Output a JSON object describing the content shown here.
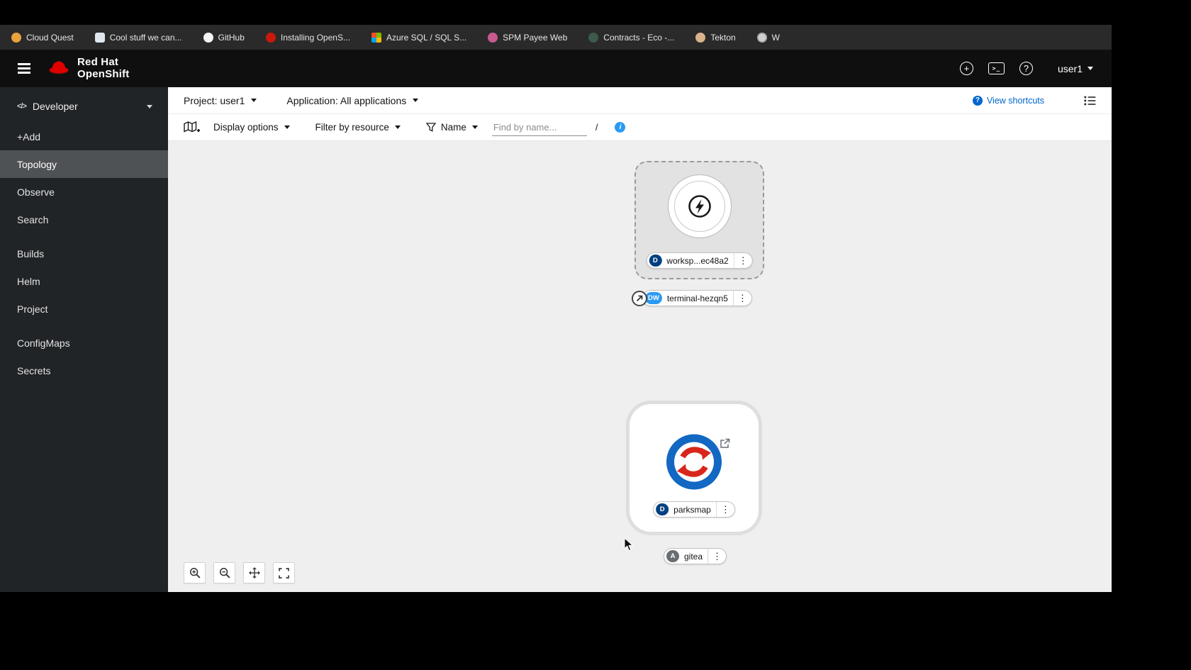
{
  "bookmarks_bar": {
    "items": [
      {
        "label": "Cloud Quest",
        "icon": "cloud-quest"
      },
      {
        "label": "Cool stuff we can...",
        "icon": "doc"
      },
      {
        "label": "GitHub",
        "icon": "github"
      },
      {
        "label": "Installing OpenS...",
        "icon": "openshift"
      },
      {
        "label": "Azure SQL / SQL S...",
        "icon": "azure"
      },
      {
        "label": "SPM Payee Web",
        "icon": "spm"
      },
      {
        "label": "Contracts - Eco -...",
        "icon": "contracts"
      },
      {
        "label": "Tekton",
        "icon": "tekton"
      },
      {
        "label": "W",
        "icon": "globe"
      }
    ]
  },
  "masthead": {
    "brand_line1": "Red Hat",
    "brand_line2": "OpenShift",
    "user": "user1"
  },
  "sidebar": {
    "perspective": "Developer",
    "items": [
      {
        "label": "+Add"
      },
      {
        "label": "Topology",
        "active": true
      },
      {
        "label": "Observe"
      },
      {
        "label": "Search"
      },
      {
        "label": "Builds",
        "spacer": true
      },
      {
        "label": "Helm"
      },
      {
        "label": "Project"
      },
      {
        "label": "ConfigMaps",
        "spacer": true
      },
      {
        "label": "Secrets"
      }
    ]
  },
  "context_bar": {
    "project": "Project: user1",
    "application": "Application: All applications",
    "view_shortcuts": "View shortcuts"
  },
  "toolbar": {
    "display_options": "Display options",
    "filter_by_resource": "Filter by resource",
    "name_filter": "Name",
    "find_placeholder": "Find by name...",
    "shortcut_key": "/"
  },
  "topology": {
    "workspace": {
      "badge": "D",
      "label": "worksp...ec48a2"
    },
    "terminal": {
      "badge": "DW",
      "label": "terminal-hezqn5"
    },
    "parksmap": {
      "badge": "D",
      "label": "parksmap"
    },
    "gitea": {
      "badge": "A",
      "label": "gitea"
    }
  },
  "glyphs": {
    "code": "</>",
    "kebab": "⋮",
    "plus": "+",
    "terminal": ">_",
    "question": "?",
    "info": "i"
  },
  "colors": {
    "accent_blue": "#0066cc",
    "badge_deployment": "#004080",
    "badge_devworkspace": "#2b9af3",
    "badge_application": "#6a6e73",
    "brand_red": "#ee0000",
    "sidebar_bg": "#212427",
    "canvas_bg": "#efefef"
  }
}
